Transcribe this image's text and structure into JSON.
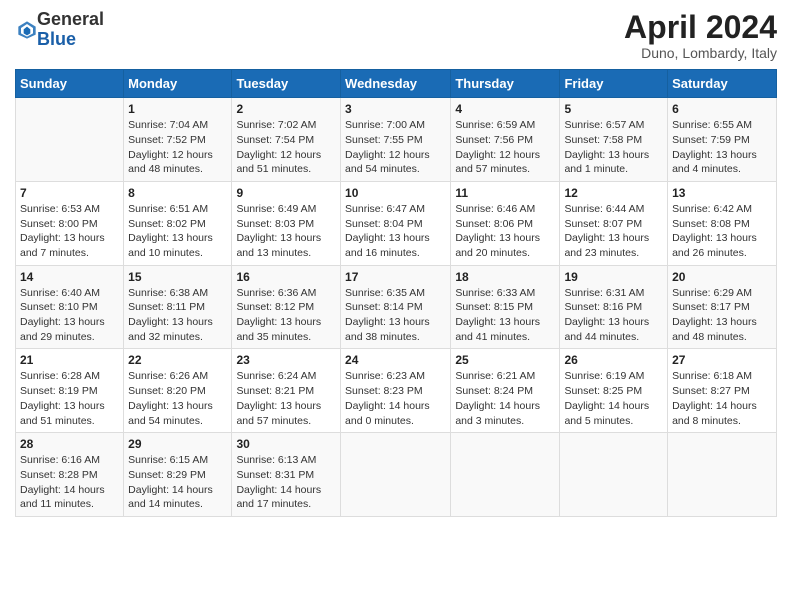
{
  "header": {
    "logo_general": "General",
    "logo_blue": "Blue",
    "month_title": "April 2024",
    "location": "Duno, Lombardy, Italy"
  },
  "days_of_week": [
    "Sunday",
    "Monday",
    "Tuesday",
    "Wednesday",
    "Thursday",
    "Friday",
    "Saturday"
  ],
  "weeks": [
    [
      {
        "day": "",
        "info": ""
      },
      {
        "day": "1",
        "info": "Sunrise: 7:04 AM\nSunset: 7:52 PM\nDaylight: 12 hours\nand 48 minutes."
      },
      {
        "day": "2",
        "info": "Sunrise: 7:02 AM\nSunset: 7:54 PM\nDaylight: 12 hours\nand 51 minutes."
      },
      {
        "day": "3",
        "info": "Sunrise: 7:00 AM\nSunset: 7:55 PM\nDaylight: 12 hours\nand 54 minutes."
      },
      {
        "day": "4",
        "info": "Sunrise: 6:59 AM\nSunset: 7:56 PM\nDaylight: 12 hours\nand 57 minutes."
      },
      {
        "day": "5",
        "info": "Sunrise: 6:57 AM\nSunset: 7:58 PM\nDaylight: 13 hours\nand 1 minute."
      },
      {
        "day": "6",
        "info": "Sunrise: 6:55 AM\nSunset: 7:59 PM\nDaylight: 13 hours\nand 4 minutes."
      }
    ],
    [
      {
        "day": "7",
        "info": "Sunrise: 6:53 AM\nSunset: 8:00 PM\nDaylight: 13 hours\nand 7 minutes."
      },
      {
        "day": "8",
        "info": "Sunrise: 6:51 AM\nSunset: 8:02 PM\nDaylight: 13 hours\nand 10 minutes."
      },
      {
        "day": "9",
        "info": "Sunrise: 6:49 AM\nSunset: 8:03 PM\nDaylight: 13 hours\nand 13 minutes."
      },
      {
        "day": "10",
        "info": "Sunrise: 6:47 AM\nSunset: 8:04 PM\nDaylight: 13 hours\nand 16 minutes."
      },
      {
        "day": "11",
        "info": "Sunrise: 6:46 AM\nSunset: 8:06 PM\nDaylight: 13 hours\nand 20 minutes."
      },
      {
        "day": "12",
        "info": "Sunrise: 6:44 AM\nSunset: 8:07 PM\nDaylight: 13 hours\nand 23 minutes."
      },
      {
        "day": "13",
        "info": "Sunrise: 6:42 AM\nSunset: 8:08 PM\nDaylight: 13 hours\nand 26 minutes."
      }
    ],
    [
      {
        "day": "14",
        "info": "Sunrise: 6:40 AM\nSunset: 8:10 PM\nDaylight: 13 hours\nand 29 minutes."
      },
      {
        "day": "15",
        "info": "Sunrise: 6:38 AM\nSunset: 8:11 PM\nDaylight: 13 hours\nand 32 minutes."
      },
      {
        "day": "16",
        "info": "Sunrise: 6:36 AM\nSunset: 8:12 PM\nDaylight: 13 hours\nand 35 minutes."
      },
      {
        "day": "17",
        "info": "Sunrise: 6:35 AM\nSunset: 8:14 PM\nDaylight: 13 hours\nand 38 minutes."
      },
      {
        "day": "18",
        "info": "Sunrise: 6:33 AM\nSunset: 8:15 PM\nDaylight: 13 hours\nand 41 minutes."
      },
      {
        "day": "19",
        "info": "Sunrise: 6:31 AM\nSunset: 8:16 PM\nDaylight: 13 hours\nand 44 minutes."
      },
      {
        "day": "20",
        "info": "Sunrise: 6:29 AM\nSunset: 8:17 PM\nDaylight: 13 hours\nand 48 minutes."
      }
    ],
    [
      {
        "day": "21",
        "info": "Sunrise: 6:28 AM\nSunset: 8:19 PM\nDaylight: 13 hours\nand 51 minutes."
      },
      {
        "day": "22",
        "info": "Sunrise: 6:26 AM\nSunset: 8:20 PM\nDaylight: 13 hours\nand 54 minutes."
      },
      {
        "day": "23",
        "info": "Sunrise: 6:24 AM\nSunset: 8:21 PM\nDaylight: 13 hours\nand 57 minutes."
      },
      {
        "day": "24",
        "info": "Sunrise: 6:23 AM\nSunset: 8:23 PM\nDaylight: 14 hours\nand 0 minutes."
      },
      {
        "day": "25",
        "info": "Sunrise: 6:21 AM\nSunset: 8:24 PM\nDaylight: 14 hours\nand 3 minutes."
      },
      {
        "day": "26",
        "info": "Sunrise: 6:19 AM\nSunset: 8:25 PM\nDaylight: 14 hours\nand 5 minutes."
      },
      {
        "day": "27",
        "info": "Sunrise: 6:18 AM\nSunset: 8:27 PM\nDaylight: 14 hours\nand 8 minutes."
      }
    ],
    [
      {
        "day": "28",
        "info": "Sunrise: 6:16 AM\nSunset: 8:28 PM\nDaylight: 14 hours\nand 11 minutes."
      },
      {
        "day": "29",
        "info": "Sunrise: 6:15 AM\nSunset: 8:29 PM\nDaylight: 14 hours\nand 14 minutes."
      },
      {
        "day": "30",
        "info": "Sunrise: 6:13 AM\nSunset: 8:31 PM\nDaylight: 14 hours\nand 17 minutes."
      },
      {
        "day": "",
        "info": ""
      },
      {
        "day": "",
        "info": ""
      },
      {
        "day": "",
        "info": ""
      },
      {
        "day": "",
        "info": ""
      }
    ]
  ]
}
